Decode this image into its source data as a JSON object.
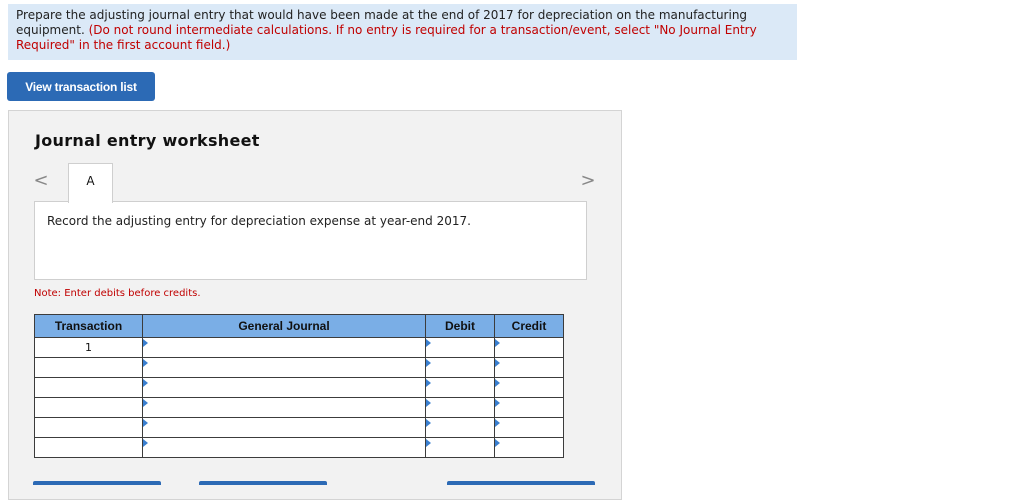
{
  "instructions": {
    "text_main": "Prepare the adjusting journal entry that would have been made at the end of 2017 for depreciation on the manufacturing equipment. ",
    "text_red": "(Do not round intermediate calculations. If no entry is required for a transaction/event, select \"No Journal Entry Required\" in the first account field.)"
  },
  "view_transaction_button": "View transaction list",
  "worksheet": {
    "title": "Journal entry worksheet",
    "nav_prev": "<",
    "nav_next": ">",
    "tab_label": "A",
    "entry_description": "Record the adjusting entry for depreciation expense at year-end 2017.",
    "note": "Note: Enter debits before credits."
  },
  "journal_table": {
    "headers": [
      "Transaction",
      "General Journal",
      "Debit",
      "Credit"
    ],
    "rows": [
      {
        "transaction": "1",
        "account": "",
        "debit": "",
        "credit": ""
      },
      {
        "transaction": "",
        "account": "",
        "debit": "",
        "credit": ""
      },
      {
        "transaction": "",
        "account": "",
        "debit": "",
        "credit": ""
      },
      {
        "transaction": "",
        "account": "",
        "debit": "",
        "credit": ""
      },
      {
        "transaction": "",
        "account": "",
        "debit": "",
        "credit": ""
      },
      {
        "transaction": "",
        "account": "",
        "debit": "",
        "credit": ""
      }
    ]
  },
  "colors": {
    "instruction_bg": "#dbe9f7",
    "button_blue": "#2c6ab5",
    "table_header": "#7aaee6",
    "red_text": "#c00000"
  }
}
